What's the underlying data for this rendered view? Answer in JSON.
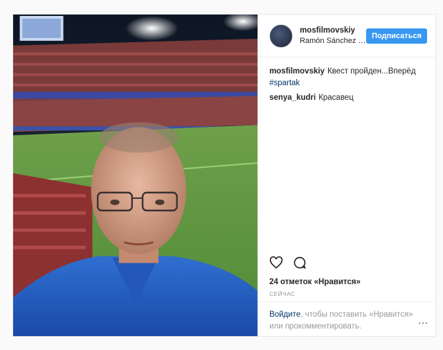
{
  "post": {
    "author": "mosfilmovskiy",
    "location": "Ramón Sánchez Pizjuán",
    "follow_label": "Подписаться",
    "comments": [
      {
        "user": "mosfilmovskiy",
        "text": "Квест пройден...Вперёд",
        "tag": "#spartak"
      },
      {
        "user": "senya_kudri",
        "text": "Красавец"
      }
    ],
    "likes": "24 отметок «Нравится»",
    "time": "СЕЙЧАС",
    "footer": {
      "login_link": "Войдите",
      "prompt_rest": ", чтобы поставить «Нравится» или прокомментировать.",
      "more": "..."
    },
    "icons": {
      "like": "heart-icon",
      "comment": "comment-icon",
      "more": "more-options-icon"
    },
    "colors": {
      "button": "#3897f0",
      "link": "#003569",
      "muted": "#999999"
    }
  }
}
